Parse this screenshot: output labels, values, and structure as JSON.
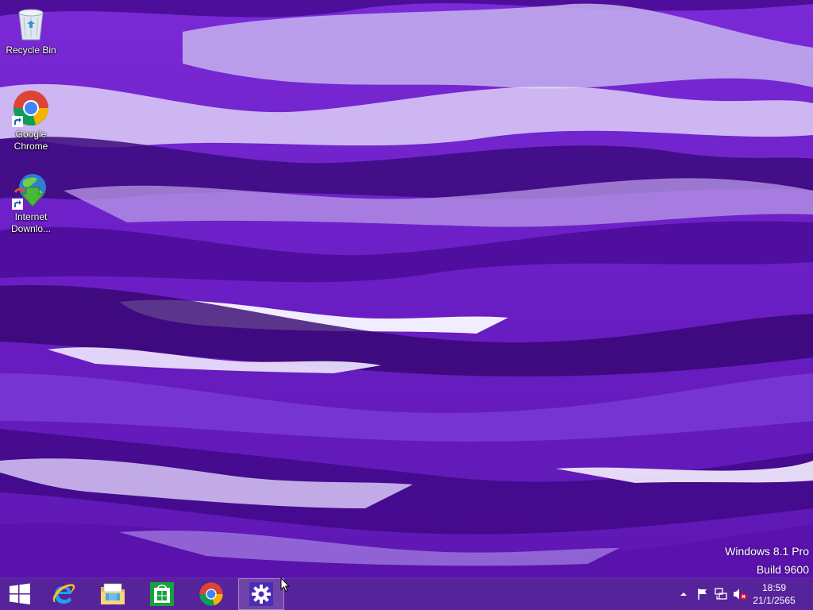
{
  "desktop": {
    "icons": [
      {
        "label": "Recycle Bin",
        "icon": "recycle-bin-icon"
      },
      {
        "label": "Google Chrome",
        "icon": "chrome-icon"
      },
      {
        "label": "Internet Downlo...",
        "icon": "internet-download-manager-icon"
      }
    ],
    "watermark": {
      "line1": "Windows 8.1 Pro",
      "line2": "Build 9600"
    }
  },
  "taskbar": {
    "buttons": [
      {
        "name": "start",
        "icon": "windows-logo-icon"
      },
      {
        "name": "internet-explorer",
        "icon": "internet-explorer-icon"
      },
      {
        "name": "file-explorer",
        "icon": "folder-icon"
      },
      {
        "name": "store",
        "icon": "store-icon"
      },
      {
        "name": "chrome",
        "icon": "chrome-icon"
      },
      {
        "name": "control-panel",
        "icon": "gear-icon",
        "active": true
      }
    ],
    "tray": {
      "icons": [
        "show-hidden-icons-arrow",
        "action-center-flag-icon",
        "network-icon",
        "volume-muted-icon"
      ],
      "time": "18:59",
      "date": "21/1/2565"
    }
  },
  "colors": {
    "wallpaper_base": "#6a1fc4",
    "taskbar": "#562496",
    "active_button": "#4b2cb5"
  }
}
